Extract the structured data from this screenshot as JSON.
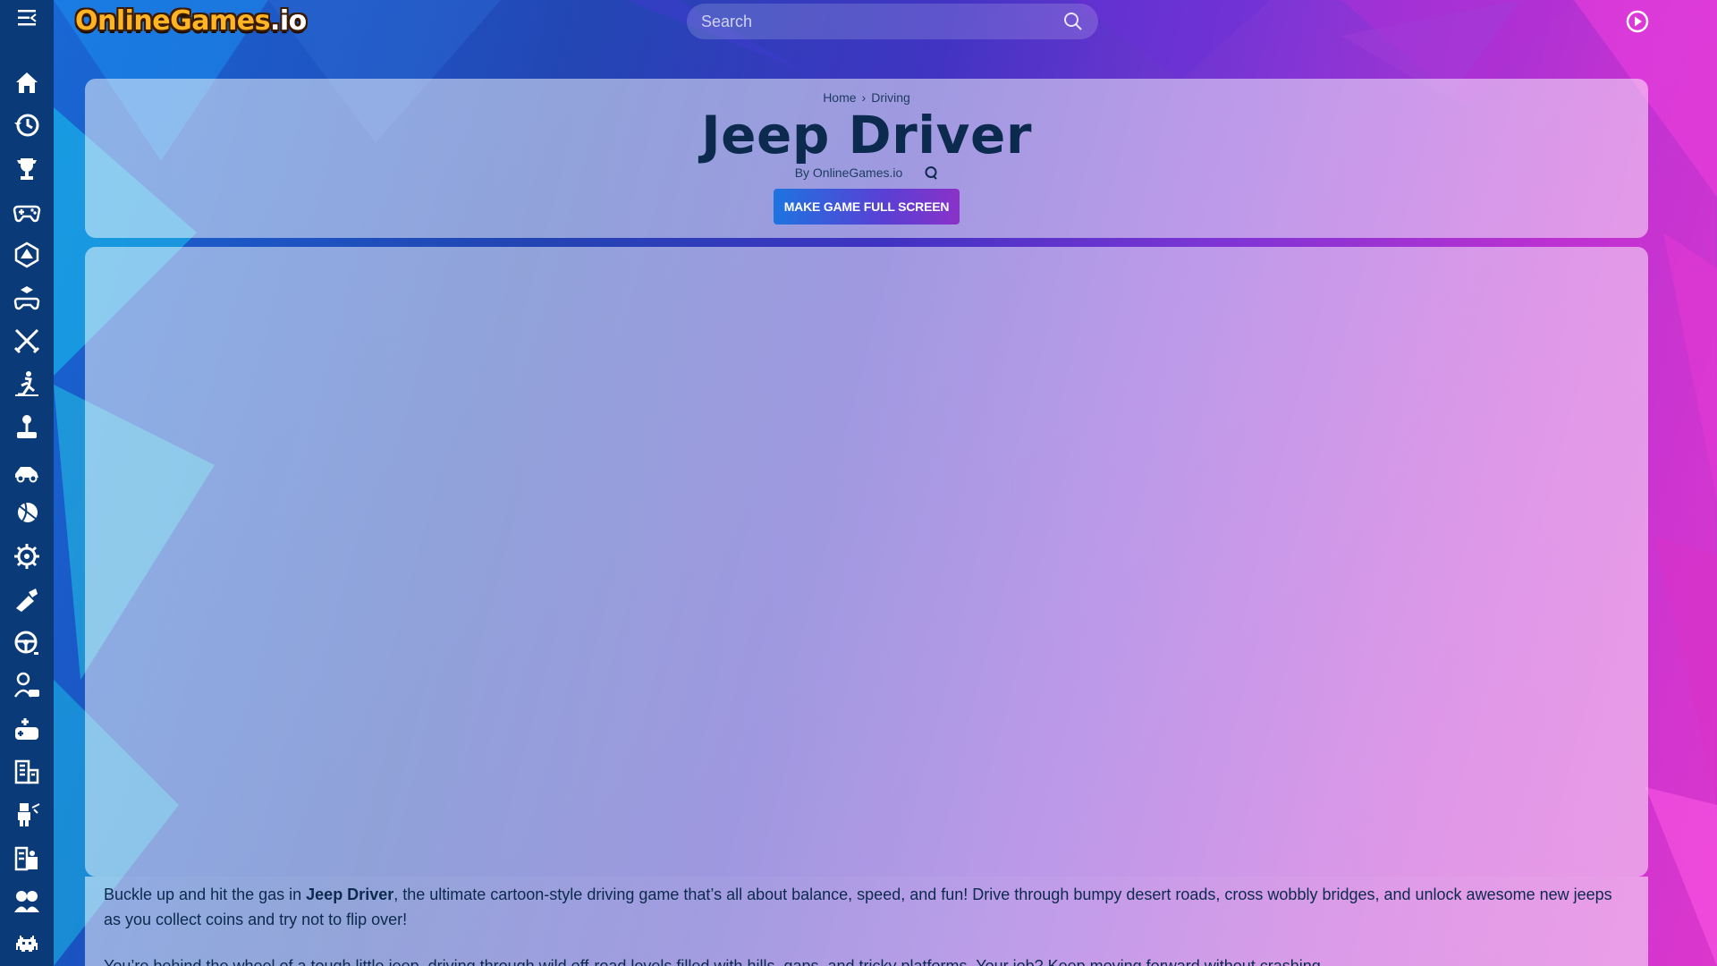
{
  "site": {
    "logo_main": "OnlineGames",
    "logo_tld": ".io"
  },
  "search": {
    "placeholder": "Search"
  },
  "sidebar": {
    "items": [
      {
        "icon": "home-icon"
      },
      {
        "icon": "history-icon"
      },
      {
        "icon": "trophy-icon"
      },
      {
        "icon": "gamepad-icon"
      },
      {
        "icon": "d20-dice-icon"
      },
      {
        "icon": "joystick-cube-icon"
      },
      {
        "icon": "crossed-swords-icon"
      },
      {
        "icon": "runner-icon"
      },
      {
        "icon": "arcade-stick-icon"
      },
      {
        "icon": "racing-car-icon"
      },
      {
        "icon": "ball-icon"
      },
      {
        "icon": "gear-icon"
      },
      {
        "icon": "shooting-icon"
      },
      {
        "icon": "steering-wheel-icon"
      },
      {
        "icon": "person-play-icon"
      },
      {
        "icon": "controller-plus-icon"
      },
      {
        "icon": "building-blocks-icon"
      },
      {
        "icon": "minecraft-figure-icon"
      },
      {
        "icon": "puzzle-pieces-icon"
      },
      {
        "icon": "two-players-icon"
      },
      {
        "icon": "space-invader-icon"
      }
    ]
  },
  "breadcrumb": {
    "home": "Home",
    "separator": "›",
    "category": "Driving"
  },
  "game": {
    "title": "Jeep Driver",
    "byline": "By OnlineGames.io",
    "fullscreen_label": "MAKE GAME FULL SCREEN"
  },
  "description": {
    "p1_before": "Buckle up and hit the gas in ",
    "p1_bold": "Jeep Driver",
    "p1_after": ", the ultimate cartoon-style driving game that’s all about balance, speed, and fun! Drive through bumpy desert roads, cross wobbly bridges, and unlock awesome new jeeps as you collect coins and try not to flip over!",
    "p2": "You’re behind the wheel of a tough little jeep, driving through wild off-road levels filled with hills, gaps, and tricky platforms. Your job? Keep moving forward without crashing."
  },
  "colors": {
    "sidebar_bg": "#0a3a78",
    "title": "#0c2a4d",
    "button_start": "#1e74e0",
    "button_end": "#8a32c8",
    "logo_orange": "#ffb423"
  }
}
